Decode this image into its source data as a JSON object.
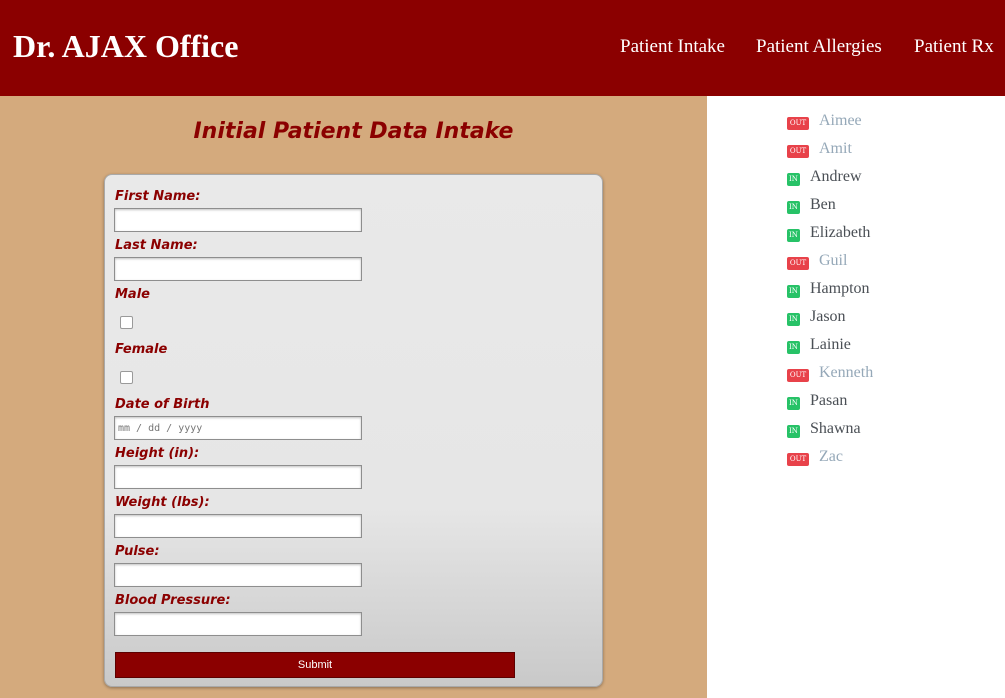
{
  "header": {
    "title": "Dr. AJAX Office",
    "nav": [
      "Patient Intake",
      "Patient Allergies",
      "Patient Rx"
    ],
    "background_color": "#8b0000"
  },
  "main": {
    "background_color": "#d4aa7d",
    "title": "Initial Patient Data Intake",
    "form": {
      "first_name": {
        "label": "First Name:",
        "value": ""
      },
      "last_name": {
        "label": "Last Name:",
        "value": ""
      },
      "male": {
        "label": "Male",
        "checked": false
      },
      "female": {
        "label": "Female",
        "checked": false
      },
      "dob": {
        "label": "Date of Birth",
        "placeholder": "mm / dd / yyyy",
        "value": ""
      },
      "height": {
        "label": "Height (in):",
        "value": ""
      },
      "weight": {
        "label": "Weight (lbs):",
        "value": ""
      },
      "pulse": {
        "label": "Pulse:",
        "value": ""
      },
      "blood_pressure": {
        "label": "Blood Pressure:",
        "value": ""
      },
      "submit_label": "Submit"
    }
  },
  "status_list": {
    "in_label": "IN",
    "out_label": "OUT",
    "in_color": "#27c267",
    "out_color": "#e8424a",
    "people": [
      {
        "name": "Aimee",
        "status": "out"
      },
      {
        "name": "Amit",
        "status": "out"
      },
      {
        "name": "Andrew",
        "status": "in"
      },
      {
        "name": "Ben",
        "status": "in"
      },
      {
        "name": "Elizabeth",
        "status": "in"
      },
      {
        "name": "Guil",
        "status": "out"
      },
      {
        "name": "Hampton",
        "status": "in"
      },
      {
        "name": "Jason",
        "status": "in"
      },
      {
        "name": "Lainie",
        "status": "in"
      },
      {
        "name": "Kenneth",
        "status": "out"
      },
      {
        "name": "Pasan",
        "status": "in"
      },
      {
        "name": "Shawna",
        "status": "in"
      },
      {
        "name": "Zac",
        "status": "out"
      }
    ]
  }
}
